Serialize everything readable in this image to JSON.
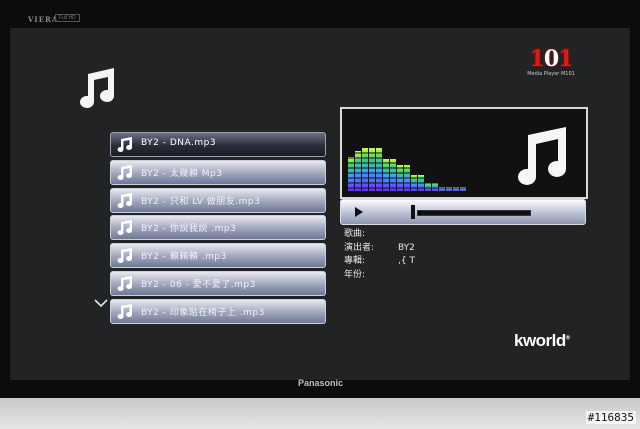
{
  "bezel": {
    "brand": "VIERA",
    "badge": "Full HD",
    "maker": "Panasonic"
  },
  "brand": {
    "number_left": "1",
    "number_mid": "0",
    "number_right": "1",
    "subtitle": "Media Player M101"
  },
  "playlist": {
    "items": [
      {
        "label": "BY2 - DNA.mp3",
        "selected": true
      },
      {
        "label": "BY2 - 太幾賴 Mp3",
        "selected": false
      },
      {
        "label": "BY2 - 只和 LV 做朋友.mp3",
        "selected": false
      },
      {
        "label": "BY2 - 你說我說 .mp3",
        "selected": false
      },
      {
        "label": "BY2 - 賴賴賴 .mp3",
        "selected": false
      },
      {
        "label": "BY2 - 06 - 愛不愛了.mp3",
        "selected": false
      },
      {
        "label": "BY2 - 印象貼在椅子上 .mp3",
        "selected": false
      }
    ]
  },
  "player": {
    "progress_fraction": 0.03
  },
  "info": {
    "song_label": "歌曲:",
    "song_value": "",
    "artist_label": "演出者:",
    "artist_value": "BY2",
    "album_label": "專輯:",
    "album_value": ",{ T",
    "year_label": "年份:",
    "year_value": ""
  },
  "logo": {
    "text": "kworld",
    "mark": "®"
  },
  "watermark": "#116835",
  "colors": {
    "accent_red": "#e01818",
    "row_light": "#9ea5bb",
    "row_selected": "#2a2d3a"
  }
}
